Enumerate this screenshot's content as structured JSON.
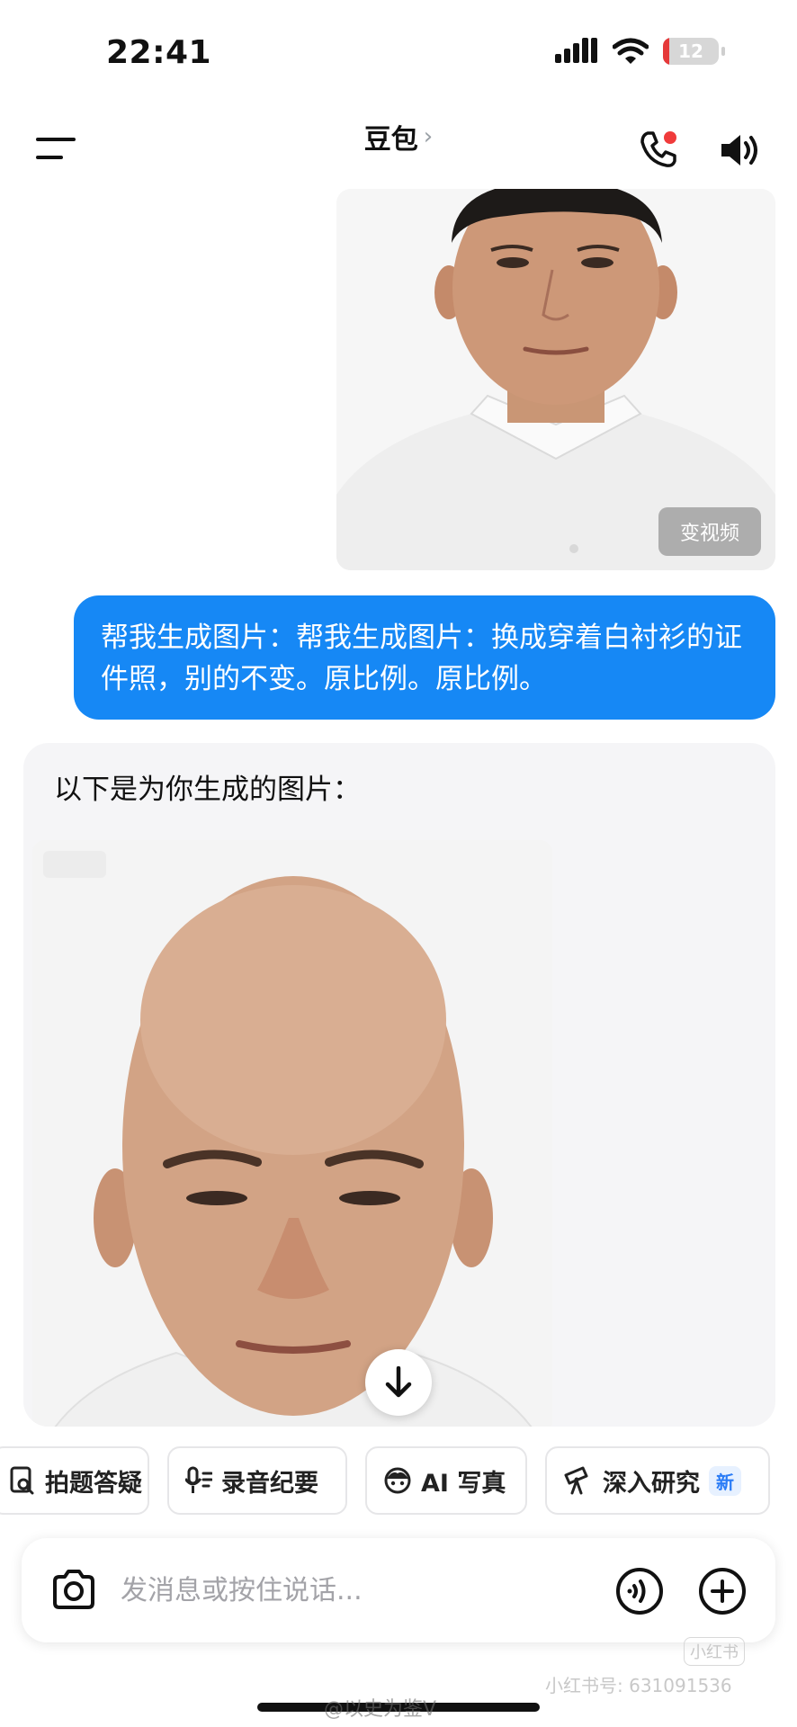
{
  "status_bar": {
    "time": "22:41",
    "battery": "12",
    "battery_level": 0.12
  },
  "header": {
    "title": "豆包",
    "chevron": "›"
  },
  "user_photo": {
    "to_video_label": "变视频"
  },
  "user_message": {
    "text": "帮我生成图片：帮我生成图片：换成穿着白衬衫的证件照，别的不变。原比例。原比例。"
  },
  "bot_message": {
    "text": "以下是为你生成的图片："
  },
  "quick_actions": [
    {
      "label": "拍题答疑",
      "icon": "search-doc-icon"
    },
    {
      "label": "录音纪要",
      "icon": "mic-notes-icon"
    },
    {
      "label": "AI 写真",
      "icon": "face-icon"
    },
    {
      "label": "深入研究",
      "icon": "telescope-icon",
      "badge": "新"
    }
  ],
  "input": {
    "placeholder": "发消息或按住说话..."
  },
  "watermarks": {
    "logo": "小红书",
    "id": "小红书号: 631091536",
    "weibo": "@以史为鉴V"
  },
  "colors": {
    "accent": "#1688f5",
    "badge": "#2a7cf6",
    "call_dot": "#f03b3b",
    "battery": "#e5393a"
  }
}
